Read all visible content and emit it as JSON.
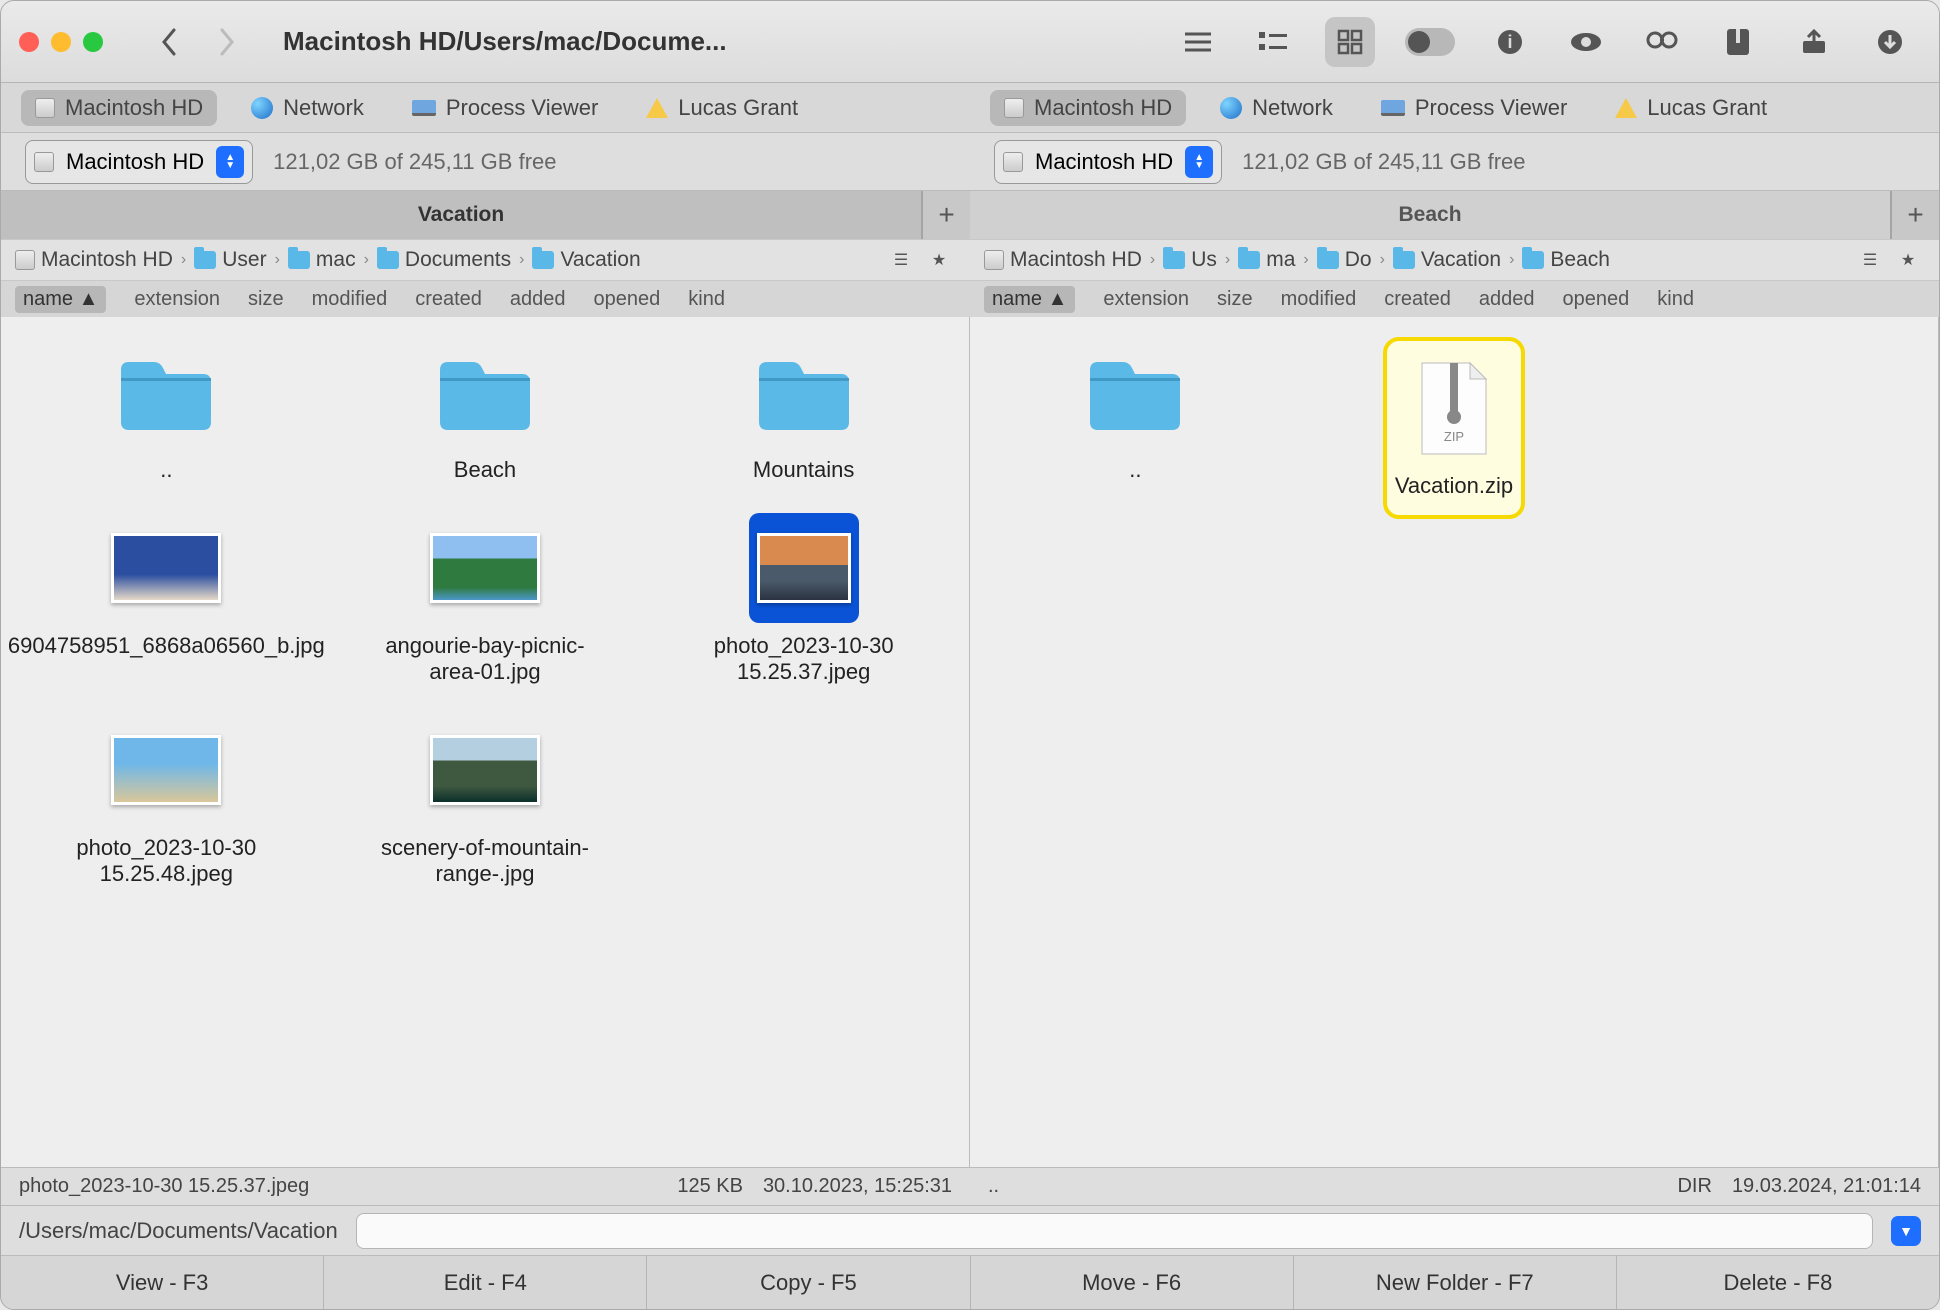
{
  "title": "Macintosh HD/Users/mac/Docume...",
  "locations": [
    {
      "label": "Macintosh HD",
      "kind": "hd",
      "active": true
    },
    {
      "label": "Network",
      "kind": "globe"
    },
    {
      "label": "Process Viewer",
      "kind": "laptop"
    },
    {
      "label": "Lucas Grant",
      "kind": "gdrive"
    }
  ],
  "volume": {
    "name": "Macintosh HD",
    "free": "121,02 GB of 245,11 GB free"
  },
  "left": {
    "tab": "Vacation",
    "crumbs": [
      "Macintosh HD",
      "User",
      "mac",
      "Documents",
      "Vacation"
    ],
    "cols": [
      "name",
      "extension",
      "size",
      "modified",
      "created",
      "added",
      "opened",
      "kind"
    ],
    "items": [
      {
        "name": "..",
        "type": "folder"
      },
      {
        "name": "Beach",
        "type": "folder"
      },
      {
        "name": "Mountains",
        "type": "folder"
      },
      {
        "name": "6904758951_6868a06560_b.jpg",
        "type": "image",
        "bg": "linear-gradient(#2b4ea0 60%,#e6d9c8)"
      },
      {
        "name": "angourie-bay-picnic-area-01.jpg",
        "type": "image",
        "bg": "linear-gradient(#8fbff0 35%,#2e7a3f 35% 80%,#4b97c9)"
      },
      {
        "name": "photo_2023-10-30 15.25.37.jpeg",
        "type": "image",
        "bg": "linear-gradient(#d88a4f 45%,#4b5a6a 45% 70%,#2a3340)",
        "selected": true
      },
      {
        "name": "photo_2023-10-30 15.25.48.jpeg",
        "type": "image",
        "bg": "linear-gradient(#6fb7e8 40%,#d9c79a)"
      },
      {
        "name": "scenery-of-mountain-range-.jpg",
        "type": "image",
        "bg": "linear-gradient(#b4cfe0 35%,#3f5840 35% 75%,#0a2f2a)"
      }
    ],
    "status": {
      "file": "photo_2023-10-30 15.25.37.jpeg",
      "size": "125 KB",
      "date": "30.10.2023, 15:25:31"
    }
  },
  "right": {
    "tab": "Beach",
    "crumbs": [
      "Macintosh HD",
      "Us",
      "ma",
      "Do",
      "Vacation",
      "Beach"
    ],
    "cols": [
      "name",
      "extension",
      "size",
      "modified",
      "created",
      "added",
      "opened",
      "kind"
    ],
    "items": [
      {
        "name": "..",
        "type": "folder"
      },
      {
        "name": "Vacation.zip",
        "type": "zip",
        "highlighted": true
      }
    ],
    "status": {
      "file": "..",
      "size": "DIR",
      "date": "19.03.2024, 21:01:14"
    }
  },
  "cmdpath": "/Users/mac/Documents/Vacation",
  "fn": [
    "View - F3",
    "Edit - F4",
    "Copy - F5",
    "Move - F6",
    "New Folder - F7",
    "Delete - F8"
  ]
}
